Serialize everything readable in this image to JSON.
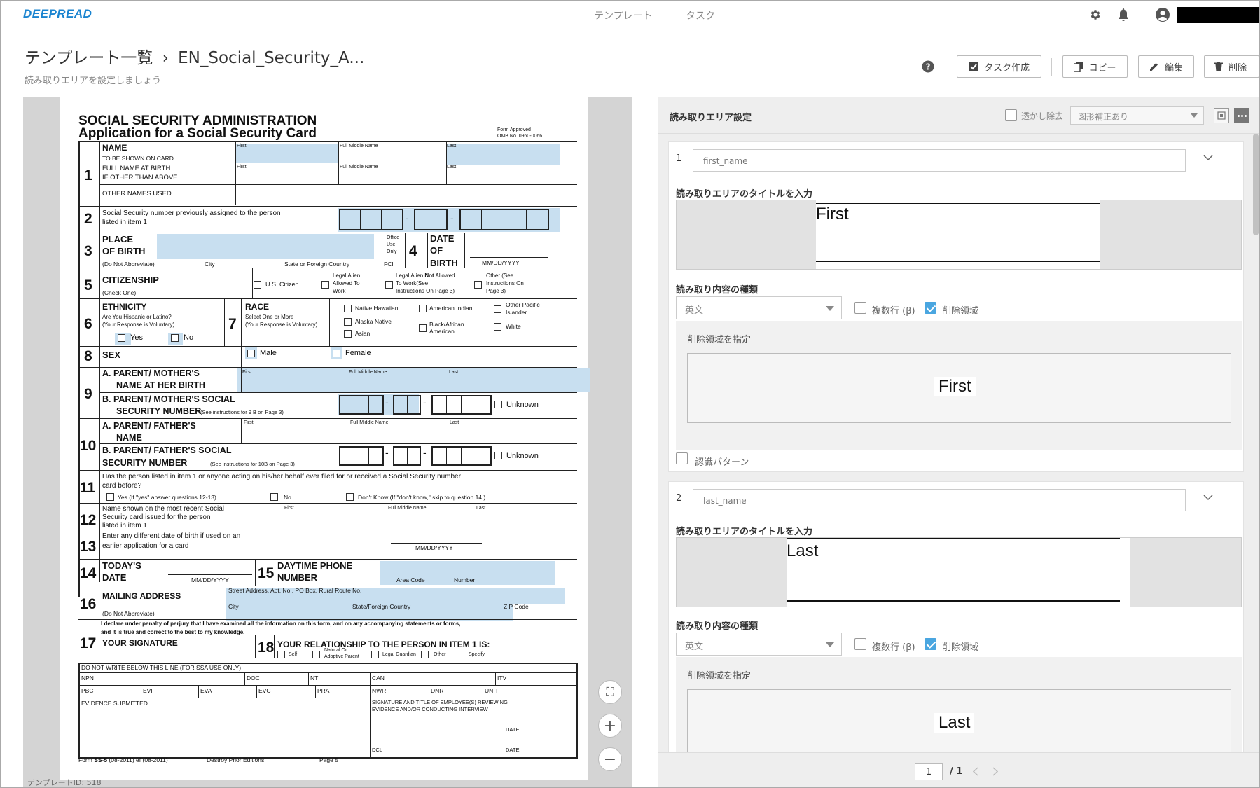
{
  "app": {
    "logo": "DEEPREAD",
    "nav": [
      "テンプレート",
      "タスク"
    ]
  },
  "header": {
    "breadcrumb_root": "テンプレート一覧",
    "breadcrumb_sep": "›",
    "breadcrumb_current": "EN_Social_Security_A...",
    "subtitle": "読み取りエリアを設定しましょう",
    "actions": {
      "create_task": "タスク作成",
      "copy": "コピー",
      "edit": "編集",
      "delete": "削除"
    }
  },
  "document": {
    "title1": "SOCIAL SECURITY ADMINISTRATION",
    "title2": "Application for a Social Security Card",
    "form_approved": "Form Approved",
    "omb": "OMB No. 0960-0066",
    "name_label": "NAME",
    "name_sub": "TO BE SHOWN ON CARD",
    "full_name_birth": "FULL NAME AT BIRTH",
    "if_other": "IF OTHER THAN ABOVE",
    "other_names": "OTHER NAMES USED",
    "first": "First",
    "full_middle": "Full Middle Name",
    "last": "Last",
    "q2_line1": "Social Security number previously assigned to the person",
    "q2_line2": "listed in item 1",
    "place": "PLACE",
    "of_birth": "OF BIRTH",
    "do_not_abbr": "(Do Not Abbreviate)",
    "city": "City",
    "state_foreign": "State or Foreign Country",
    "office": "Office",
    "use": "Use",
    "only": "Only",
    "fci": "FCI",
    "date": "DATE",
    "of": "OF",
    "birth": "BIRTH",
    "mmddyyyy": "MM/DD/YYYY",
    "citizenship": "CITIZENSHIP",
    "check_one": "(Check One)",
    "us_citizen": "U.S. Citizen",
    "legal_alien_1": "Legal Alien",
    "legal_alien_2": "Allowed To",
    "legal_alien_3": "Work",
    "legal_not_1a": "Legal Alien ",
    "legal_not_1b": "Not",
    "legal_not_1c": " Allowed",
    "legal_not_2": "To Work(See",
    "legal_not_3": "Instructions On Page 3)",
    "other_see_1": "Other (See",
    "other_see_2": "Instructions On",
    "other_see_3": "Page 3)",
    "ethnicity": "ETHNICITY",
    "hispanic_q": "Are You Hispanic or Latino?",
    "voluntary": "(Your Response is Voluntary)",
    "yes": "Yes",
    "no": "No",
    "race": "RACE",
    "select_more": "Select One or More",
    "native_hawaiian": "Native Hawaiian",
    "alaska_native": "Alaska Native",
    "asian": "Asian",
    "american_indian": "American Indian",
    "black_1": "Black/African",
    "black_2": "American",
    "other_pacific_1": "Other Pacific",
    "other_pacific_2": "Islander",
    "white": "White",
    "sex": "SEX",
    "male": "Male",
    "female": "Female",
    "mother_1": "A. PARENT/ MOTHER'S",
    "mother_2": "NAME  AT HER BIRTH",
    "mother_ssn_1": "B. PARENT/ MOTHER'S SOCIAL",
    "mother_ssn_2": "SECURITY NUMBER",
    "mother_ssn_note": "(See instructions for 9 B on Page 3)",
    "unknown": "Unknown",
    "father_1": "A. PARENT/ FATHER'S",
    "father_2": "NAME",
    "father_ssn_1": "B. PARENT/ FATHER'S SOCIAL",
    "father_ssn_2": "SECURITY NUMBER",
    "father_ssn_note": "(See instructions for 10B on Page 3)",
    "q11_1": "Has the person listed in item 1 or anyone acting on his/her behalf ever filed for or received a Social Security number",
    "q11_2": "card before?",
    "q11_yes": "Yes (If \"yes\" answer questions 12-13)",
    "q11_no": "No",
    "q11_dk": "Don't Know (If \"don't know,\" skip to question 14.)",
    "q12_1": "Name shown on the most recent Social",
    "q12_2": "Security card issued for the person",
    "q12_3": "listed in item 1",
    "q13_1": "Enter any different date of birth if used on an",
    "q13_2": "earlier application for a card",
    "todays": "TODAY'S",
    "date_cap": "DATE",
    "daytime_1": "DAYTIME PHONE",
    "daytime_2": "NUMBER",
    "area_code": "Area Code",
    "number": "Number",
    "mailing": "MAILING ADDRESS",
    "street": "Street Address, Apt. No., PO Box, Rural Route No.",
    "city_state": "State/Foreign Country",
    "zip": "ZIP Code",
    "declare_1": "I declare under penalty of perjury that I have examined all the information on this form, and on any accompanying statements or forms,",
    "declare_2": "and it is true and correct to the best to my knowledge.",
    "your_sig": "YOUR SIGNATURE",
    "relationship": "YOUR RELATIONSHIP TO THE PERSON IN ITEM 1 IS:",
    "self": "Self",
    "natural_1": "Natural Or",
    "natural_2": "Adoptive Parent",
    "legal_guardian": "Legal Guardian",
    "other": "Other",
    "specify": "Specify",
    "dnw": "DO NOT WRITE BELOW THIS LINE (FOR SSA USE ONLY)",
    "npn": "NPN",
    "doc": "DOC",
    "nti": "NTI",
    "can": "CAN",
    "itv": "ITV",
    "pbc": "PBC",
    "evi": "EVI",
    "eva": "EVA",
    "evc": "EVC",
    "pra": "PRA",
    "nwr": "NWR",
    "dnr": "DNR",
    "unit": "UNIT",
    "evidence": "EVIDENCE SUBMITTED",
    "sig_title_1": "SIGNATURE AND TITLE OF EMPLOYEE(S) REVIEWING",
    "sig_title_2": "EVIDENCE AND/OR CONDUCTING INTERVIEW",
    "dcl": "DCL",
    "form_no_a": "Form ",
    "form_no_b": "SS-5",
    "form_no_c": " (08-2011) ef (08-2011)",
    "destroy": "Destroy Prior Editions",
    "page": "Page 5",
    "nums": [
      "1",
      "2",
      "3",
      "4",
      "5",
      "6",
      "7",
      "8",
      "9",
      "10",
      "11",
      "12",
      "13",
      "14",
      "15",
      "16",
      "17",
      "18"
    ]
  },
  "template_id": "テンプレートID: 518",
  "panel": {
    "title": "読み取りエリア設定",
    "watermark_label": "透かし除去",
    "watermark_checked": false,
    "correction_value": "図形補正あり",
    "areas": [
      {
        "index": "1",
        "name": "first_name",
        "title_label": "読み取りエリアのタイトルを入力",
        "preview_text": "First",
        "type_label": "読み取り内容の種類",
        "type_value": "英文",
        "multiline_label": "複数行 (β)",
        "multiline_checked": false,
        "delete_label": "削除領域",
        "delete_checked": true,
        "delete_specify": "削除領域を指定",
        "delete_text": "First",
        "pattern_label": "認識パターン",
        "pattern_checked": false
      },
      {
        "index": "2",
        "name": "last_name",
        "title_label": "読み取りエリアのタイトルを入力",
        "preview_text": "Last",
        "type_label": "読み取り内容の種類",
        "type_value": "英文",
        "multiline_label": "複数行 (β)",
        "multiline_checked": false,
        "delete_label": "削除領域",
        "delete_checked": true,
        "delete_specify": "削除領域を指定",
        "delete_text": "Last"
      }
    ],
    "pager": {
      "current": "1",
      "total": "/ 1"
    }
  },
  "zoom": {
    "fit": "⛶",
    "in": "+",
    "out": "−"
  }
}
